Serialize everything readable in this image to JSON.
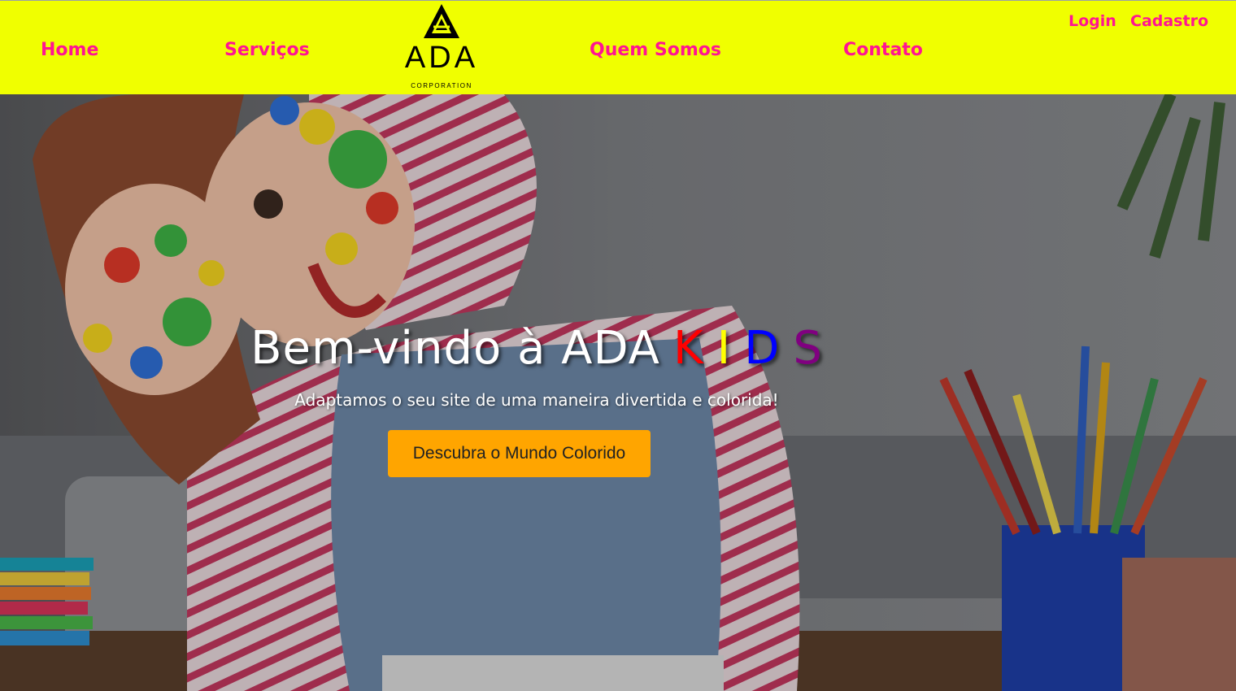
{
  "nav": {
    "home": "Home",
    "services": "Serviços",
    "about": "Quem Somos",
    "contact": "Contato",
    "login": "Login",
    "register": "Cadastro"
  },
  "logo": {
    "name": "ADA",
    "tagline": "CORPORATION",
    "icon": "triangle-logo-icon"
  },
  "hero": {
    "title_prefix": "Bem-vindo à ADA",
    "kids_letters": [
      "K",
      "I",
      "D",
      "S"
    ],
    "kids_colors": [
      "#ff0000",
      "#ffff00",
      "#0000ff",
      "#800080"
    ],
    "subtitle": "Adaptamos o seu site de uma maneira divertida e colorida!",
    "cta_label": "Descubra o Mundo Colorido"
  },
  "colors": {
    "navbar_bg": "#f0ff00",
    "nav_link": "#ff1493",
    "cta_bg": "#ffa500"
  }
}
